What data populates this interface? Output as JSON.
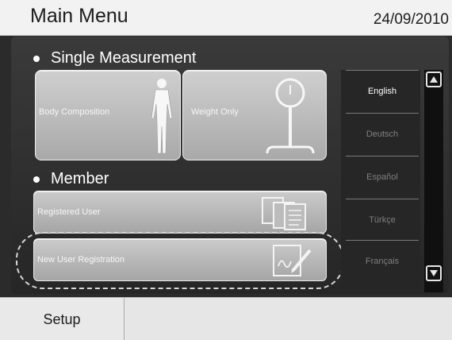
{
  "header": {
    "title": "Main Menu",
    "date": "24/09/2010"
  },
  "single_measurement": {
    "heading": "Single Measurement",
    "buttons": [
      {
        "label": "Body Composition",
        "icon": "body-icon"
      },
      {
        "label": "Weight Only",
        "icon": "scale-icon"
      }
    ]
  },
  "member": {
    "heading": "Member",
    "buttons": [
      {
        "label": "Registered User",
        "icon": "documents-icon"
      },
      {
        "label": "New User Registration",
        "icon": "sign-document-icon"
      }
    ]
  },
  "languages": {
    "items": [
      "English",
      "Deutsch",
      "Español",
      "Türkçe",
      "Français"
    ],
    "selected": "English"
  },
  "footer": {
    "setup_label": "Setup"
  }
}
